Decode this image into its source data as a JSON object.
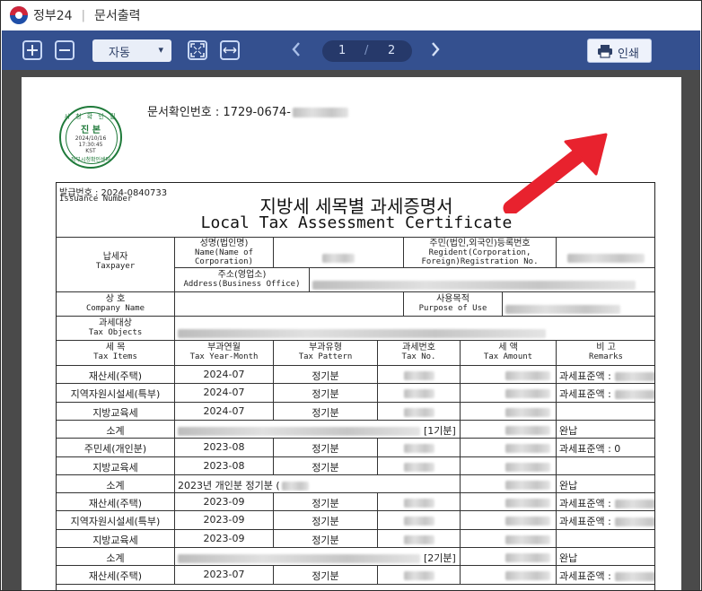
{
  "titlebar": {
    "app_name": "정부24",
    "separator": "|",
    "window_title": "문서출력"
  },
  "toolbar": {
    "zoom_value": "자동",
    "page_current": "1",
    "page_separator": "/",
    "page_total": "2",
    "print_label": "인쇄"
  },
  "document": {
    "doc_check_label": "문서확인번호  :  1729-0674-",
    "stamp": {
      "top": "시 청 확 인 필",
      "center": "진 본",
      "date": "2024/10/16",
      "time": "17:30:45",
      "tz": "KST",
      "bottom": "정부시청확인센터"
    },
    "issue_label": "발급번호  :  2024-0840733",
    "issue_label_en": "Issuance Number",
    "title_ko": "지방세 세목별 과세증명서",
    "title_en": "Local Tax Assessment Certificate",
    "taxpayer_ko": "납세자",
    "taxpayer_en": "Taxpayer",
    "name_ko": "성명(법인명)",
    "name_en1": "Name(Name of",
    "name_en2": "Corporation)",
    "regno_ko": "주민(법인,외국인)등록번호",
    "regno_en1": "Regident(Corporation,",
    "regno_en2": "Foreign)Registration No.",
    "address_ko": "주소(영업소)",
    "address_en": "Address(Business Office)",
    "company_ko": "상      호",
    "company_en": "Company Name",
    "purpose_ko": "사용목적",
    "purpose_en": "Purpose of Use",
    "objects_ko": "과세대상",
    "objects_en": "Tax Objects",
    "headers": [
      {
        "ko": "세      목",
        "en": "Tax Items"
      },
      {
        "ko": "부과연월",
        "en": "Tax Year-Month"
      },
      {
        "ko": "부과유형",
        "en": "Tax Pattern"
      },
      {
        "ko": "과세번호",
        "en": "Tax No."
      },
      {
        "ko": "세      액",
        "en": "Tax Amount"
      },
      {
        "ko": "비      고",
        "en": "Remarks"
      }
    ],
    "rows": [
      {
        "item": "재산세(주택)",
        "ym": "2024-07",
        "type": "정기분",
        "remark": "과세표준액 :"
      },
      {
        "item": "지역자원시설세(특부)",
        "ym": "2024-07",
        "type": "정기분",
        "remark": "과세표준액 :"
      },
      {
        "item": "지방교육세",
        "ym": "2024-07",
        "type": "정기분",
        "remark": ""
      },
      {
        "item": "소계",
        "ym": "",
        "type": "",
        "extra": "[1기분]",
        "remark": "완납"
      },
      {
        "item": "주민세(개인분)",
        "ym": "2023-08",
        "type": "정기분",
        "remark": "과세표준액 : 0"
      },
      {
        "item": "지방교육세",
        "ym": "2023-08",
        "type": "정기분",
        "remark": ""
      },
      {
        "item": "소계",
        "ym": "2023년 개인분 정기분 (",
        "type": "",
        "remark": "완납"
      },
      {
        "item": "재산세(주택)",
        "ym": "2023-09",
        "type": "정기분",
        "remark": "과세표준액 :"
      },
      {
        "item": "지역자원시설세(특부)",
        "ym": "2023-09",
        "type": "정기분",
        "remark": "과세표준액 :"
      },
      {
        "item": "지방교육세",
        "ym": "2023-09",
        "type": "정기분",
        "remark": ""
      },
      {
        "item": "소계",
        "ym": "",
        "type": "",
        "extra": "[2기분]",
        "remark": "완납"
      },
      {
        "item": "재산세(주택)",
        "ym": "2023-07",
        "type": "정기분",
        "remark": "과세표준액 :"
      }
    ]
  },
  "colors": {
    "toolbar": "#34508f",
    "viewer_bg": "#4a4a4a",
    "arrow": "#e8222e"
  }
}
